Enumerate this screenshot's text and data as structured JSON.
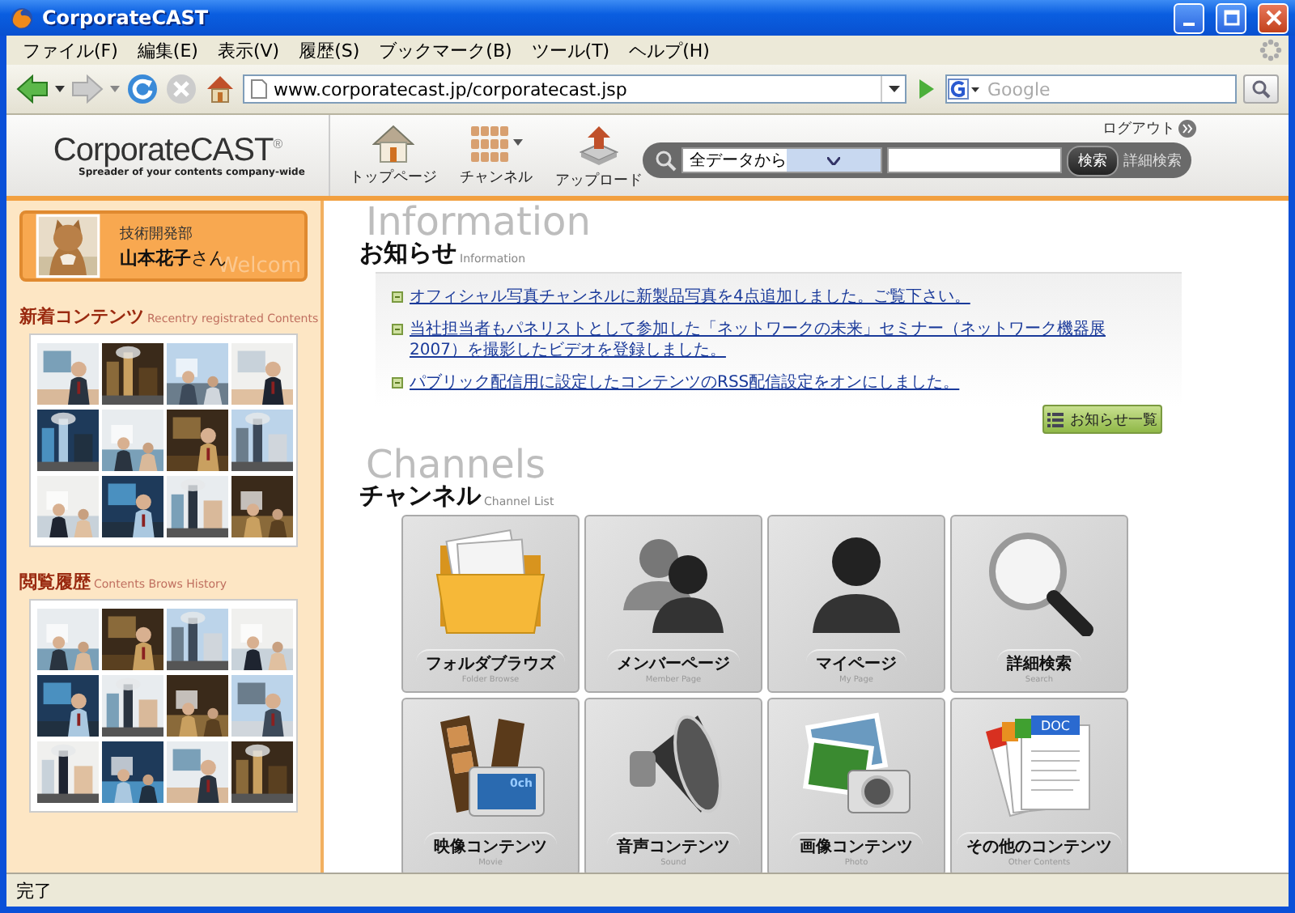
{
  "window": {
    "title": "CorporateCAST"
  },
  "menu": [
    "ファイル(F)",
    "編集(E)",
    "表示(V)",
    "履歴(S)",
    "ブックマーク(B)",
    "ツール(T)",
    "ヘルプ(H)"
  ],
  "address_bar": {
    "url": "www.corporatecast.jp/corporatecast.jsp"
  },
  "search_bar": {
    "placeholder": "Google"
  },
  "site_header": {
    "logo": "CorporateCAST$^{®}$",
    "tagline": "Spreader of your contents company-wide",
    "logout": "ログアウト",
    "nav": [
      {
        "label": "トップページ"
      },
      {
        "label": "チャンネル"
      },
      {
        "label": "アップロード"
      }
    ],
    "search": {
      "scope": "全データから",
      "button": "検索",
      "advanced": "詳細検索"
    }
  },
  "profile": {
    "department": "技術開発部",
    "name": "**山本花子**さん",
    "watermark": "Welcom"
  },
  "new_contents": {
    "title": "新着コンテンツ",
    "subtitle": "Recentry registrated Contents"
  },
  "history": {
    "title": "閲覧履歴",
    "subtitle": "Contents Brows History"
  },
  "news": {
    "title": "お知らせ",
    "subtitle": "Information",
    "watermark": "Information",
    "items": [
      "オフィシャル写真チャンネルに新製品写真を4点追加しました。ご覧下さい。",
      "当社担当者もパネリストとして参加した「ネットワークの未来」セミナー（ネットワーク機器展2007）を撮影したビデオを登録しました。",
      "パブリック配信用に設定したコンテンツのRSS配信設定をオンにしました。"
    ],
    "more_button": "お知らせ一覧"
  },
  "channels": {
    "title": "チャンネル",
    "subtitle": "Channel List",
    "watermark": "Channels",
    "items": [
      {
        "label": "フォルダブラウズ",
        "sublabel": "Folder Browse"
      },
      {
        "label": "メンバーページ",
        "sublabel": "Member Page"
      },
      {
        "label": "マイページ",
        "sublabel": "My Page"
      },
      {
        "label": "詳細検索",
        "sublabel": "Search"
      },
      {
        "label": "映像コンテンツ",
        "sublabel": "Movie",
        "badge": "0ch"
      },
      {
        "label": "音声コンテンツ",
        "sublabel": "Sound"
      },
      {
        "label": "画像コンテンツ",
        "sublabel": "Photo"
      },
      {
        "label": "その他のコンテンツ",
        "sublabel": "Other Contents",
        "badge": "DOC"
      }
    ]
  },
  "status_bar": {
    "text": "完了"
  }
}
